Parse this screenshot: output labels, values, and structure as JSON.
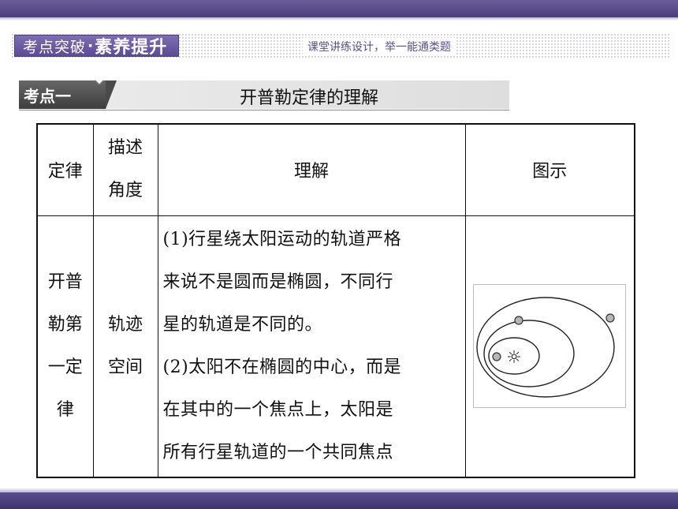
{
  "section": {
    "label_part1": "考点突破",
    "label_dot": "·",
    "label_part2": "素养提升",
    "subtitle": "课堂讲练设计，举一能通类题"
  },
  "topic": {
    "tag": "考点一",
    "title": "开普勒定律的理解"
  },
  "table": {
    "headers": {
      "law": "定律",
      "aspect_line1": "描述",
      "aspect_line2": "角度",
      "understanding": "理解",
      "illustration": "图示"
    },
    "row1": {
      "law_lines": [
        "开普",
        "勒第",
        "一定",
        "律"
      ],
      "aspect_lines": [
        "轨迹",
        "空间"
      ],
      "explain_lines": [
        "(1)行星绕太阳运动的轨道严格",
        "来说不是圆而是椭圆，不同行",
        "星的轨道是不同的。",
        "(2)太阳不在椭圆的中心，而是",
        "在其中的一个焦点上，太阳是",
        "所有行星轨道的一个共同焦点"
      ]
    }
  },
  "diagram": {
    "sun_symbol": "☼",
    "orbit_count": 3,
    "planet_count": 3
  }
}
